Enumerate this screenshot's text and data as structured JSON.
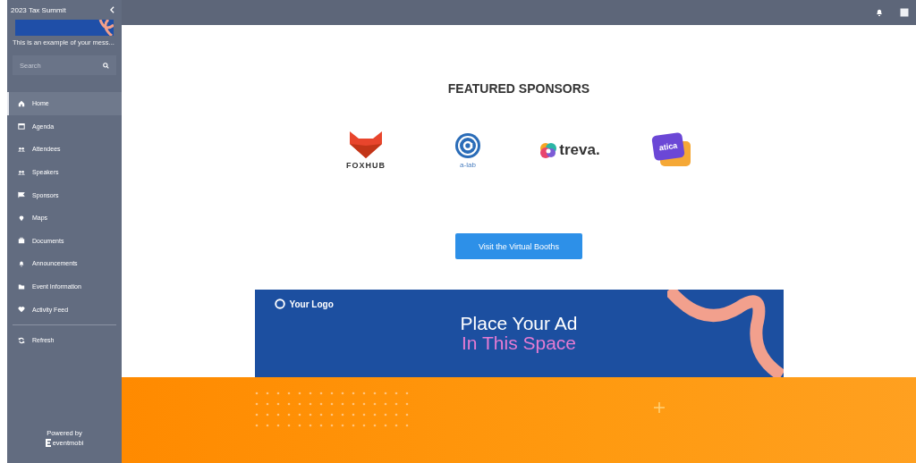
{
  "sidebar": {
    "title": "2023 Tax Summit",
    "message": "This is an example of your mess...",
    "search": {
      "placeholder": "Search"
    },
    "items": [
      {
        "label": "Home",
        "selected": true
      },
      {
        "label": "Agenda",
        "selected": false
      },
      {
        "label": "Attendees",
        "selected": false
      },
      {
        "label": "Speakers",
        "selected": false
      },
      {
        "label": "Sponsors",
        "selected": false
      },
      {
        "label": "Maps",
        "selected": false
      },
      {
        "label": "Documents",
        "selected": false
      },
      {
        "label": "Announcements",
        "selected": false
      },
      {
        "label": "Event Information",
        "selected": false
      },
      {
        "label": "Activity Feed",
        "selected": false
      }
    ],
    "refresh": "Refresh",
    "powered_by": "Powered by",
    "brand": "eventmobi"
  },
  "main": {
    "heading": "FEATURED SPONSORS",
    "sponsors": [
      {
        "kind": "fox",
        "name": "FOXHUB"
      },
      {
        "kind": "badge",
        "name": "a-lab"
      },
      {
        "kind": "blob",
        "name": "treva."
      },
      {
        "kind": "cards",
        "name": "atica"
      }
    ],
    "button": "Visit the Virtual Booths",
    "ad": {
      "logo": "Your Logo",
      "line_1": "Place Your Ad",
      "line_2": "In This Space"
    }
  }
}
